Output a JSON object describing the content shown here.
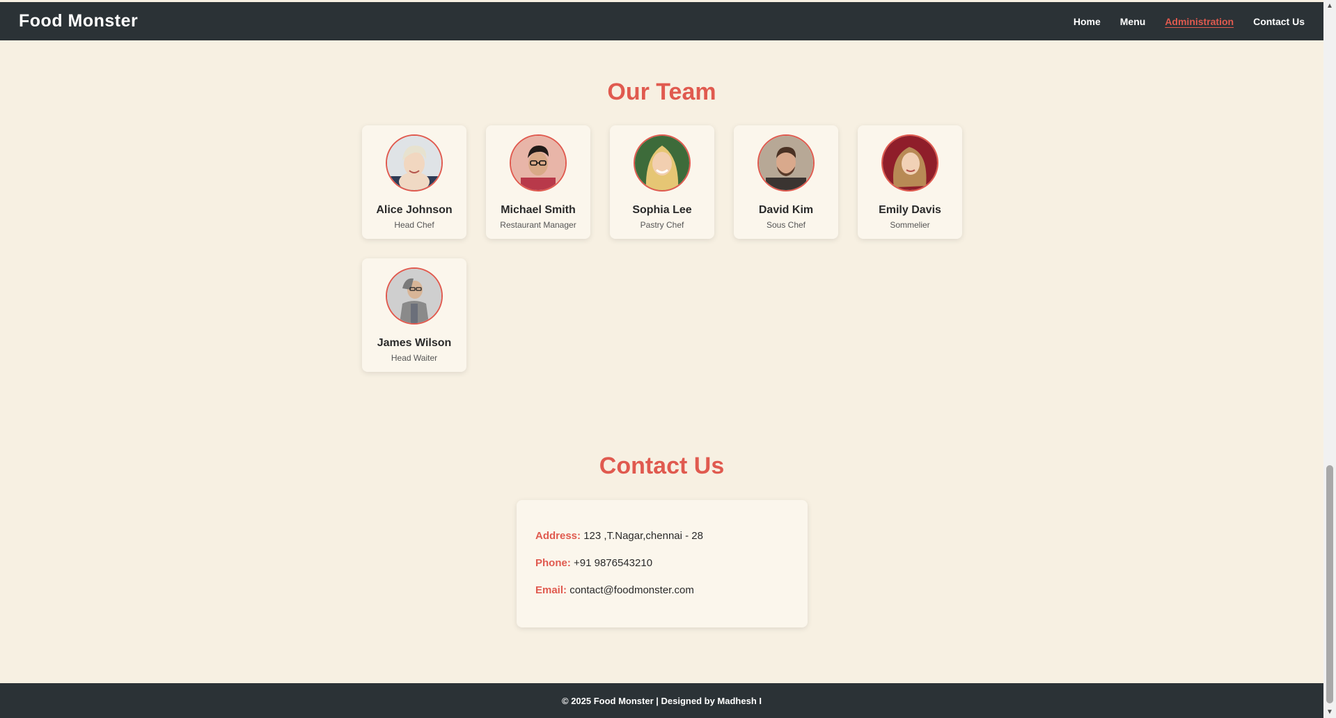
{
  "header": {
    "brand": "Food Monster",
    "nav": [
      {
        "label": "Home"
      },
      {
        "label": "Menu"
      },
      {
        "label": "Administration",
        "active": true
      },
      {
        "label": "Contact Us"
      }
    ]
  },
  "team": {
    "title": "Our Team",
    "members": [
      {
        "name": "Alice Johnson",
        "role": "Head Chef"
      },
      {
        "name": "Michael Smith",
        "role": "Restaurant Manager"
      },
      {
        "name": "Sophia Lee",
        "role": "Pastry Chef"
      },
      {
        "name": "David Kim",
        "role": "Sous Chef"
      },
      {
        "name": "Emily Davis",
        "role": "Sommelier"
      },
      {
        "name": "James Wilson",
        "role": "Head Waiter"
      }
    ]
  },
  "contact": {
    "title": "Contact Us",
    "address_label": "Address:",
    "address": "123 ,T.Nagar,chennai - 28",
    "phone_label": "Phone:",
    "phone": "+91 9876543210",
    "email_label": "Email:",
    "email": "contact@foodmonster.com"
  },
  "footer": {
    "text": "© 2025 Food Monster | Designed by Madhesh I"
  },
  "colors": {
    "accent": "#e05a4f",
    "dark": "#2b3236",
    "background": "#f7f0e2"
  },
  "icons": {
    "scroll_up": "triangle-up-icon",
    "scroll_down": "triangle-down-icon"
  }
}
